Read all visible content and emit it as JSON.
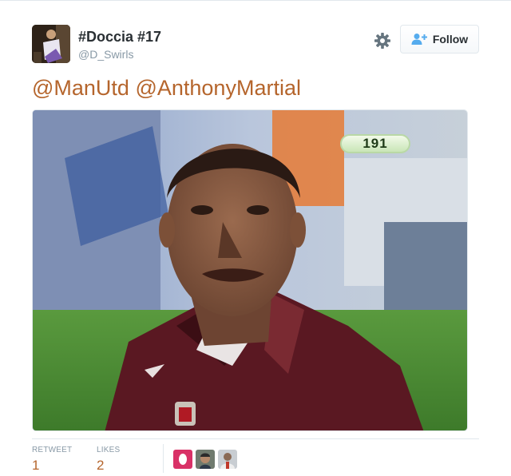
{
  "user": {
    "display_name": "#Doccia #17",
    "handle": "@D_Swirls"
  },
  "actions": {
    "follow_label": "Follow"
  },
  "tweet": {
    "mentions": [
      "@ManUtd",
      "@AnthonyMartial"
    ]
  },
  "media": {
    "overlay_number": "191"
  },
  "stats": {
    "retweets_label": "RETWEET",
    "retweets_count": "1",
    "likes_label": "LIKES",
    "likes_count": "2"
  },
  "icons": {
    "settings": "gear-icon",
    "follow": "add-user-icon"
  },
  "colors": {
    "link": "#b5652c",
    "muted": "#8899a6",
    "text": "#292f33",
    "border": "#e1e8ed"
  }
}
